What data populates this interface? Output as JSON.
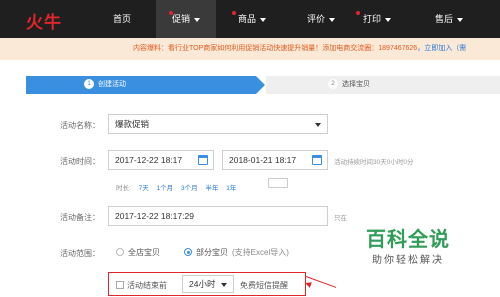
{
  "nav": {
    "logo": "火牛",
    "items": [
      {
        "label": "首页"
      },
      {
        "label": "促销"
      },
      {
        "label": "商品"
      },
      {
        "label": "评价"
      },
      {
        "label": "打印"
      },
      {
        "label": "售后"
      }
    ]
  },
  "notice": {
    "text": "内容爆料：看行业TOP商家如何利用促销活动快速提升销量！添加电商交流圈：1897467626",
    "link": "，立即加入（需"
  },
  "steps": {
    "step1_num": "1",
    "step1_label": "创建活动",
    "step2_num": "2",
    "step2_label": "选择宝贝"
  },
  "form": {
    "name_label": "活动名称：",
    "name_value": "爆款促销",
    "time_label": "活动时间：",
    "start_time": "2017-12-22 18:17",
    "end_time": "2018-01-21 18:17",
    "duration_hint": "活动持续时间30天0小时0分",
    "quick_label": "时长:",
    "quick_options": [
      "7天",
      "1个月",
      "3个月",
      "半年",
      "1年"
    ],
    "remark_label": "活动备注：",
    "remark_value": "2017-12-22 18:17:29",
    "remark_hint": "只在",
    "scope_label": "活动范围：",
    "scope_all": "全店宝贝",
    "scope_part": "部分宝贝",
    "scope_part_hint": "(支持Excel导入)",
    "sms_check": "活动结束前",
    "sms_hours": "24小时",
    "sms_label": "免费短信提醒"
  },
  "watermark": {
    "title": "百科全说",
    "subtitle": "助你轻松解决"
  },
  "colors": {
    "nav_bg": "#1f1f1f",
    "brand_red": "#e0252b",
    "step_blue": "#3b8fe0",
    "notice_bg": "#fbe9d8",
    "watermark_green": "#2f9d55"
  }
}
